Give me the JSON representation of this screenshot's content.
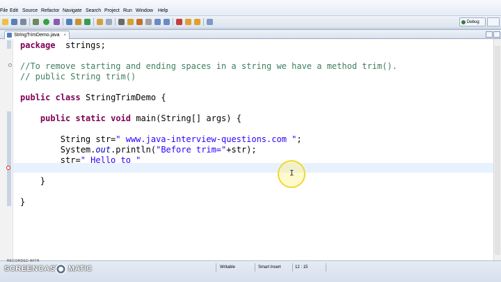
{
  "menu": [
    "File",
    "Edit",
    "Source",
    "Refactor",
    "Navigate",
    "Search",
    "Project",
    "Run",
    "Window",
    "Help"
  ],
  "perspective": {
    "label": "Debug"
  },
  "editor": {
    "tab_title": "StringTrimDemo.java",
    "close_glyph": "×",
    "lines": [
      [
        [
          "kw",
          "package"
        ],
        [
          "",
          "  strings;"
        ]
      ],
      [],
      [
        [
          "cm",
          "//To remove starting and ending spaces in a string we have a method trim()."
        ]
      ],
      [
        [
          "cm",
          "// public String trim()"
        ]
      ],
      [],
      [
        [
          "kw",
          "public"
        ],
        [
          "",
          " "
        ],
        [
          "kw",
          "class"
        ],
        [
          "",
          " StringTrimDemo {"
        ]
      ],
      [],
      [
        [
          "",
          "    "
        ],
        [
          "kw",
          "public"
        ],
        [
          "",
          " "
        ],
        [
          "kw",
          "static"
        ],
        [
          "",
          " "
        ],
        [
          "kw",
          "void"
        ],
        [
          "",
          " main(String[] args) {"
        ]
      ],
      [],
      [
        [
          "",
          "        String str="
        ],
        [
          "str",
          "\" www.java-interview-questions.com \""
        ],
        [
          "",
          ";"
        ]
      ],
      [
        [
          "",
          "        System."
        ],
        [
          "it",
          "out"
        ],
        [
          "",
          ".println("
        ],
        [
          "str",
          "\"Before trim=\""
        ],
        [
          "",
          "+str);"
        ]
      ],
      [
        [
          "",
          "        str="
        ],
        [
          "str",
          "\" Hello to \""
        ]
      ],
      [],
      [
        [
          "",
          "    }"
        ]
      ],
      [],
      [
        [
          "",
          "}"
        ]
      ]
    ]
  },
  "status": {
    "writable": "Writable",
    "insert_mode": "Smart Insert",
    "position": "12 : 15"
  },
  "watermark": {
    "line1": "RECORDED WITH",
    "brand_left": "SCREENCAST",
    "brand_right": "MATIC"
  }
}
